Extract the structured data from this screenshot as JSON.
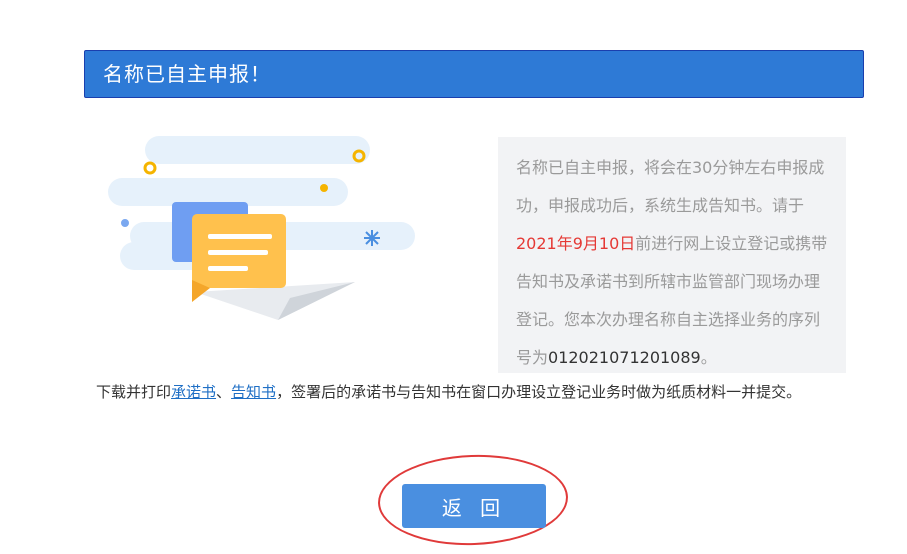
{
  "banner": {
    "title": "名称已自主申报！"
  },
  "info": {
    "text_before_date": "名称已自主申报，将会在30分钟左右申报成功，申报成功后，系统生成告知书。请于",
    "date": "2021年9月10日",
    "text_after_date": "前进行网上设立登记或携带告知书及承诺书到所辖市监管部门现场办理登记。您本次办理名称自主选择业务的序列号为",
    "serial": "012021071201089",
    "end": "。"
  },
  "notice": {
    "prefix": "下载并打印",
    "link_commitment": "承诺书",
    "separator": "、",
    "link_notification": "告知书",
    "suffix": "，签署后的承诺书与告知书在窗口办理设立登记业务时做为纸质材料一并提交。"
  },
  "actions": {
    "return_label": "返 回"
  },
  "colors": {
    "banner": "#2e7ad6",
    "button": "#4a8fe0",
    "date_highlight": "#e53935",
    "link": "#1f6fc5",
    "annotation_ring": "#e03a3a"
  },
  "icons": [
    "document-send-illustration"
  ]
}
